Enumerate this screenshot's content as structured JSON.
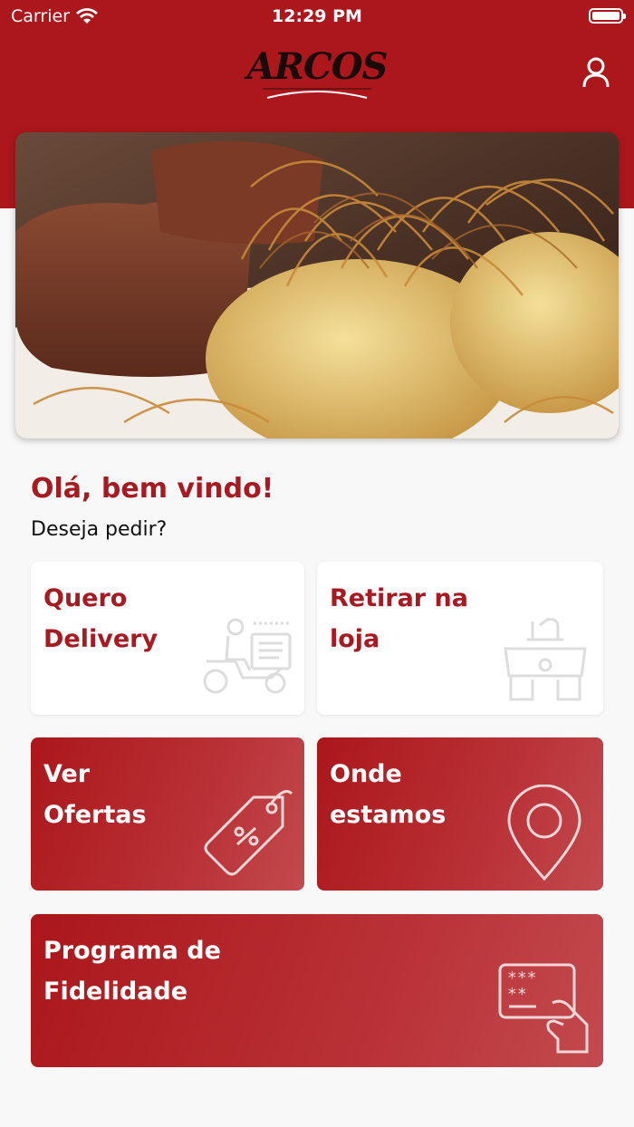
{
  "status_bar": {
    "carrier": "Carrier",
    "time": "12:29 PM"
  },
  "header": {
    "logo_text": "ARCOS"
  },
  "welcome": {
    "title": "Olá, bem vindo!",
    "subtitle": "Deseja pedir?"
  },
  "cards": {
    "delivery": {
      "line1": "Quero",
      "line2": "Delivery",
      "icon": "delivery-scooter-icon"
    },
    "pickup": {
      "line1": "Retirar na",
      "line2": "loja",
      "icon": "store-pickup-icon"
    },
    "offers": {
      "line1": "Ver",
      "line2": "Ofertas",
      "icon": "discount-tag-icon"
    },
    "locations": {
      "line1": "Onde",
      "line2": "estamos",
      "icon": "location-pin-icon"
    },
    "loyalty": {
      "line1": "Programa de",
      "line2": "Fidelidade",
      "icon": "card-payment-icon"
    }
  },
  "colors": {
    "brand_red": "#ab171b",
    "title_red": "#a81a21",
    "background": "#f8f8f8"
  }
}
